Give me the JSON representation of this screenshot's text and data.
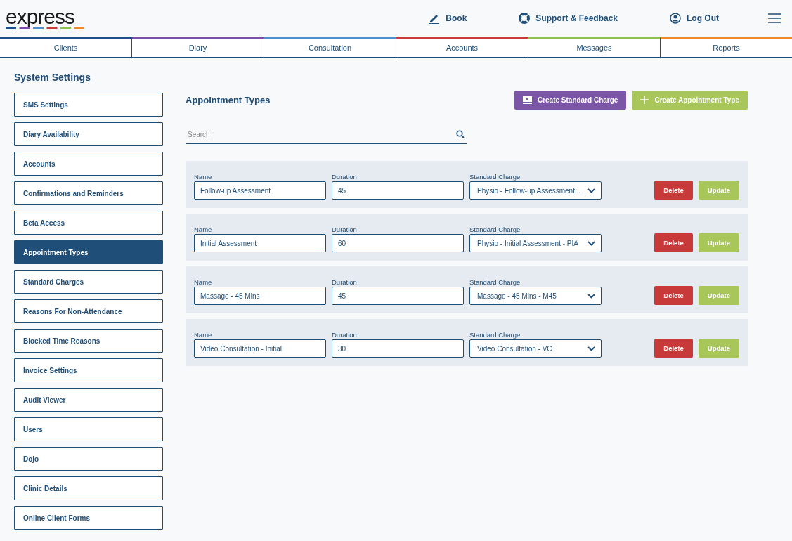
{
  "header": {
    "logo": "express",
    "links": [
      {
        "kind": "book",
        "label": "Book"
      },
      {
        "kind": "support",
        "label": "Support & Feedback"
      },
      {
        "kind": "user",
        "label": "Log Out"
      }
    ]
  },
  "tabs": [
    {
      "label": "Clients",
      "color": "#1f4e8c"
    },
    {
      "label": "Diary",
      "color": "#7b4fa6"
    },
    {
      "label": "Consultation",
      "color": "#4e8fd0"
    },
    {
      "label": "Accounts",
      "color": "#c83a3a"
    },
    {
      "label": "Messages",
      "color": "#8fc14e"
    },
    {
      "label": "Reports",
      "color": "#ef8a2c"
    }
  ],
  "sidebar": {
    "title": "System Settings",
    "items": [
      {
        "label": "SMS Settings",
        "selected": false
      },
      {
        "label": "Diary Availability",
        "selected": false
      },
      {
        "label": "Accounts",
        "selected": false
      },
      {
        "label": "Confirmations and Reminders",
        "selected": false
      },
      {
        "label": "Beta Access",
        "selected": false
      },
      {
        "label": "Appointment Types",
        "selected": true
      },
      {
        "label": "Standard Charges",
        "selected": false
      },
      {
        "label": "Reasons For Non-Attendance",
        "selected": false
      },
      {
        "label": "Blocked Time Reasons",
        "selected": false
      },
      {
        "label": "Invoice Settings",
        "selected": false
      },
      {
        "label": "Audit Viewer",
        "selected": false
      },
      {
        "label": "Users",
        "selected": false
      },
      {
        "label": "Dojo",
        "selected": false
      },
      {
        "label": "Clinic Details",
        "selected": false
      },
      {
        "label": "Online Client Forms",
        "selected": false
      }
    ]
  },
  "main": {
    "title": "Appointment Types",
    "buttons": [
      {
        "kind": "charge",
        "label": "Create Standard Charge"
      },
      {
        "kind": "add",
        "label": "Create Appointment Type"
      }
    ],
    "search": {
      "placeholder": "Search"
    },
    "rows": [
      {
        "name_label": "Name",
        "name": "Follow-up Assessment",
        "duration_label": "Duration",
        "duration": "45",
        "charge_label": "Standard Charge",
        "charge": "Physio - Follow-up Assessment...",
        "delete": "Delete",
        "update": "Update",
        "update_disabled": true
      },
      {
        "name_label": "Name",
        "name": "Initial Assessment",
        "duration_label": "Duration",
        "duration": "60",
        "charge_label": "Standard Charge",
        "charge": "Physio - Initial Assessment - PIA",
        "delete": "Delete",
        "update": "Update",
        "update_disabled": true
      },
      {
        "name_label": "Name",
        "name": "Massage - 45 Mins",
        "duration_label": "Duration",
        "duration": "45",
        "charge_label": "Standard Charge",
        "charge": "Massage - 45 Mins - M45",
        "delete": "Delete",
        "update": "Update",
        "update_disabled": true
      },
      {
        "name_label": "Name",
        "name": "Video Consultation - Initial",
        "duration_label": "Duration",
        "duration": "30",
        "charge_label": "Standard Charge",
        "charge": "Video Consultation - VC",
        "delete": "Delete",
        "update": "Update",
        "update_disabled": true
      }
    ]
  }
}
